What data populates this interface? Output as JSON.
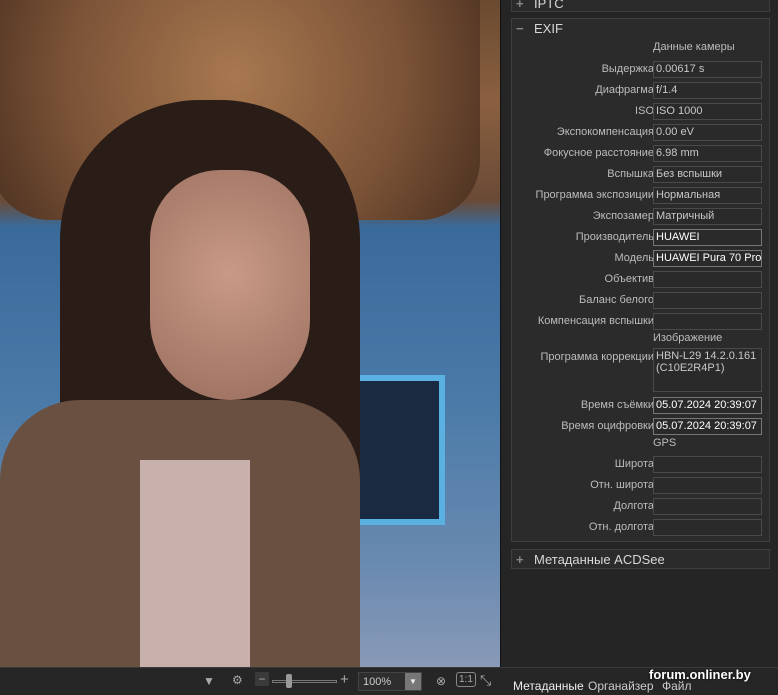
{
  "panel": {
    "iptc": {
      "toggle": "+",
      "title": "IPTC"
    },
    "exif": {
      "toggle": "−",
      "title": "EXIF",
      "groups": {
        "camera": "Данные камеры",
        "image": "Изображение",
        "gps": "GPS"
      },
      "rows": [
        {
          "label": "Выдержка",
          "value": "0.00617 s"
        },
        {
          "label": "Диафрагма",
          "value": "f/1.4"
        },
        {
          "label": "ISO",
          "value": "ISO 1000"
        },
        {
          "label": "Экспокомпенсация",
          "value": "0.00 eV"
        },
        {
          "label": "Фокусное расстояние",
          "value": "6.98 mm"
        },
        {
          "label": "Вспышка",
          "value": "Без вспышки"
        },
        {
          "label": "Программа экспозиции",
          "value": "Нормальная"
        },
        {
          "label": "Экспозамер",
          "value": "Матричный"
        },
        {
          "label": "Производитель",
          "value": "HUAWEI"
        },
        {
          "label": "Модель",
          "value": "HUAWEI Pura 70 Pro"
        },
        {
          "label": "Объектив",
          "value": ""
        },
        {
          "label": "Баланс белого",
          "value": ""
        },
        {
          "label": "Компенсация вспышки",
          "value": ""
        },
        {
          "label": "Программа коррекции",
          "value": "HBN-L29 14.2.0.161 (C10E2R4P1)"
        },
        {
          "label": "Время съёмки",
          "value": "05.07.2024 20:39:07"
        },
        {
          "label": "Время оцифровки",
          "value": "05.07.2024 20:39:07"
        },
        {
          "label": "Широта",
          "value": ""
        },
        {
          "label": "Отн. широта",
          "value": ""
        },
        {
          "label": "Долгота",
          "value": ""
        },
        {
          "label": "Отн. долгота",
          "value": ""
        }
      ]
    },
    "acdsee": {
      "toggle": "+",
      "title": "Метаданные ACDSee"
    }
  },
  "toolbar": {
    "zoom": "100%",
    "one_to_one": "1:1"
  },
  "tabs": [
    "Метаданные",
    "Органайзер",
    "Файл"
  ],
  "watermark": "forum.onliner.by"
}
